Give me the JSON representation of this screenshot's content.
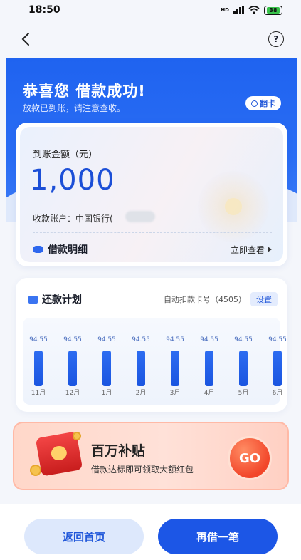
{
  "status_bar": {
    "time": "18:50",
    "network": "HD",
    "battery": "38"
  },
  "nav": {
    "help_glyph": "?"
  },
  "hero": {
    "title": "恭喜您 借款成功!",
    "subtitle": "放款已到账，请注意查收。",
    "flip_label": "翻卡"
  },
  "amount_card": {
    "label": "到账金额（元）",
    "amount": "1,000",
    "account_label": "收款账户：中国银行(",
    "detail_label": "借款明细",
    "detail_link": "立即查看"
  },
  "repay_plan": {
    "title": "还款计划",
    "auto_debit": "自动扣款卡号（4505）",
    "settings_label": "设置",
    "installments": [
      {
        "amount": "94.55",
        "month": "11月"
      },
      {
        "amount": "94.55",
        "month": "12月"
      },
      {
        "amount": "94.55",
        "month": "1月"
      },
      {
        "amount": "94.55",
        "month": "2月"
      },
      {
        "amount": "94.55",
        "month": "3月"
      },
      {
        "amount": "94.55",
        "month": "4月"
      },
      {
        "amount": "94.55",
        "month": "5月"
      },
      {
        "amount": "94.55",
        "month": "6月"
      }
    ]
  },
  "promo": {
    "title": "百万补贴",
    "subtitle": "借款达标即可领取大额红包",
    "go_label": "GO"
  },
  "bottom": {
    "home_label": "返回首页",
    "borrow_label": "再借一笔"
  },
  "colors": {
    "brand_blue": "#1f63f0",
    "amount_blue": "#1c4fd7",
    "promo_red": "#f2462a"
  }
}
